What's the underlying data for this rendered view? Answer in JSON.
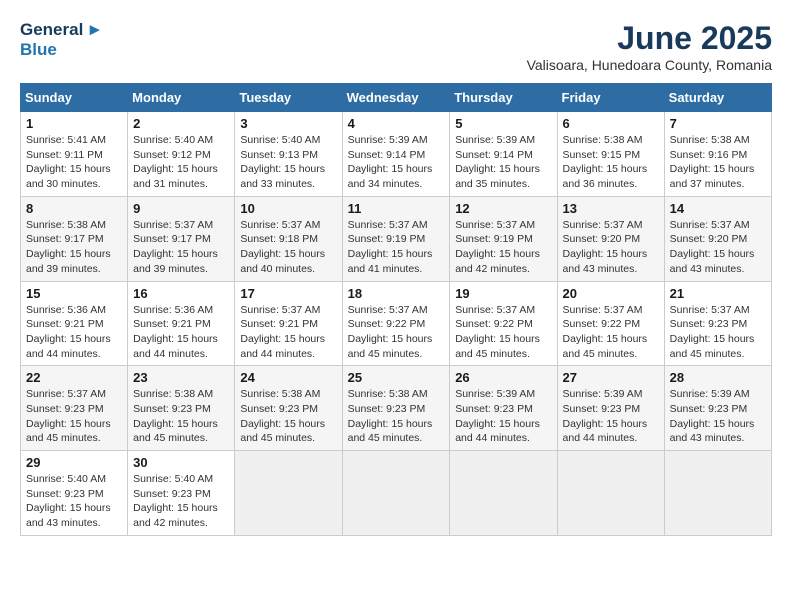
{
  "logo": {
    "line1": "General",
    "line2": "Blue"
  },
  "title": "June 2025",
  "subtitle": "Valisoara, Hunedoara County, Romania",
  "days_header": [
    "Sunday",
    "Monday",
    "Tuesday",
    "Wednesday",
    "Thursday",
    "Friday",
    "Saturday"
  ],
  "weeks": [
    [
      {
        "day": "1",
        "info": "Sunrise: 5:41 AM\nSunset: 9:11 PM\nDaylight: 15 hours\nand 30 minutes."
      },
      {
        "day": "2",
        "info": "Sunrise: 5:40 AM\nSunset: 9:12 PM\nDaylight: 15 hours\nand 31 minutes."
      },
      {
        "day": "3",
        "info": "Sunrise: 5:40 AM\nSunset: 9:13 PM\nDaylight: 15 hours\nand 33 minutes."
      },
      {
        "day": "4",
        "info": "Sunrise: 5:39 AM\nSunset: 9:14 PM\nDaylight: 15 hours\nand 34 minutes."
      },
      {
        "day": "5",
        "info": "Sunrise: 5:39 AM\nSunset: 9:14 PM\nDaylight: 15 hours\nand 35 minutes."
      },
      {
        "day": "6",
        "info": "Sunrise: 5:38 AM\nSunset: 9:15 PM\nDaylight: 15 hours\nand 36 minutes."
      },
      {
        "day": "7",
        "info": "Sunrise: 5:38 AM\nSunset: 9:16 PM\nDaylight: 15 hours\nand 37 minutes."
      }
    ],
    [
      {
        "day": "8",
        "info": "Sunrise: 5:38 AM\nSunset: 9:17 PM\nDaylight: 15 hours\nand 39 minutes."
      },
      {
        "day": "9",
        "info": "Sunrise: 5:37 AM\nSunset: 9:17 PM\nDaylight: 15 hours\nand 39 minutes."
      },
      {
        "day": "10",
        "info": "Sunrise: 5:37 AM\nSunset: 9:18 PM\nDaylight: 15 hours\nand 40 minutes."
      },
      {
        "day": "11",
        "info": "Sunrise: 5:37 AM\nSunset: 9:19 PM\nDaylight: 15 hours\nand 41 minutes."
      },
      {
        "day": "12",
        "info": "Sunrise: 5:37 AM\nSunset: 9:19 PM\nDaylight: 15 hours\nand 42 minutes."
      },
      {
        "day": "13",
        "info": "Sunrise: 5:37 AM\nSunset: 9:20 PM\nDaylight: 15 hours\nand 43 minutes."
      },
      {
        "day": "14",
        "info": "Sunrise: 5:37 AM\nSunset: 9:20 PM\nDaylight: 15 hours\nand 43 minutes."
      }
    ],
    [
      {
        "day": "15",
        "info": "Sunrise: 5:36 AM\nSunset: 9:21 PM\nDaylight: 15 hours\nand 44 minutes."
      },
      {
        "day": "16",
        "info": "Sunrise: 5:36 AM\nSunset: 9:21 PM\nDaylight: 15 hours\nand 44 minutes."
      },
      {
        "day": "17",
        "info": "Sunrise: 5:37 AM\nSunset: 9:21 PM\nDaylight: 15 hours\nand 44 minutes."
      },
      {
        "day": "18",
        "info": "Sunrise: 5:37 AM\nSunset: 9:22 PM\nDaylight: 15 hours\nand 45 minutes."
      },
      {
        "day": "19",
        "info": "Sunrise: 5:37 AM\nSunset: 9:22 PM\nDaylight: 15 hours\nand 45 minutes."
      },
      {
        "day": "20",
        "info": "Sunrise: 5:37 AM\nSunset: 9:22 PM\nDaylight: 15 hours\nand 45 minutes."
      },
      {
        "day": "21",
        "info": "Sunrise: 5:37 AM\nSunset: 9:23 PM\nDaylight: 15 hours\nand 45 minutes."
      }
    ],
    [
      {
        "day": "22",
        "info": "Sunrise: 5:37 AM\nSunset: 9:23 PM\nDaylight: 15 hours\nand 45 minutes."
      },
      {
        "day": "23",
        "info": "Sunrise: 5:38 AM\nSunset: 9:23 PM\nDaylight: 15 hours\nand 45 minutes."
      },
      {
        "day": "24",
        "info": "Sunrise: 5:38 AM\nSunset: 9:23 PM\nDaylight: 15 hours\nand 45 minutes."
      },
      {
        "day": "25",
        "info": "Sunrise: 5:38 AM\nSunset: 9:23 PM\nDaylight: 15 hours\nand 45 minutes."
      },
      {
        "day": "26",
        "info": "Sunrise: 5:39 AM\nSunset: 9:23 PM\nDaylight: 15 hours\nand 44 minutes."
      },
      {
        "day": "27",
        "info": "Sunrise: 5:39 AM\nSunset: 9:23 PM\nDaylight: 15 hours\nand 44 minutes."
      },
      {
        "day": "28",
        "info": "Sunrise: 5:39 AM\nSunset: 9:23 PM\nDaylight: 15 hours\nand 43 minutes."
      }
    ],
    [
      {
        "day": "29",
        "info": "Sunrise: 5:40 AM\nSunset: 9:23 PM\nDaylight: 15 hours\nand 43 minutes."
      },
      {
        "day": "30",
        "info": "Sunrise: 5:40 AM\nSunset: 9:23 PM\nDaylight: 15 hours\nand 42 minutes."
      },
      {
        "day": "",
        "info": ""
      },
      {
        "day": "",
        "info": ""
      },
      {
        "day": "",
        "info": ""
      },
      {
        "day": "",
        "info": ""
      },
      {
        "day": "",
        "info": ""
      }
    ]
  ]
}
